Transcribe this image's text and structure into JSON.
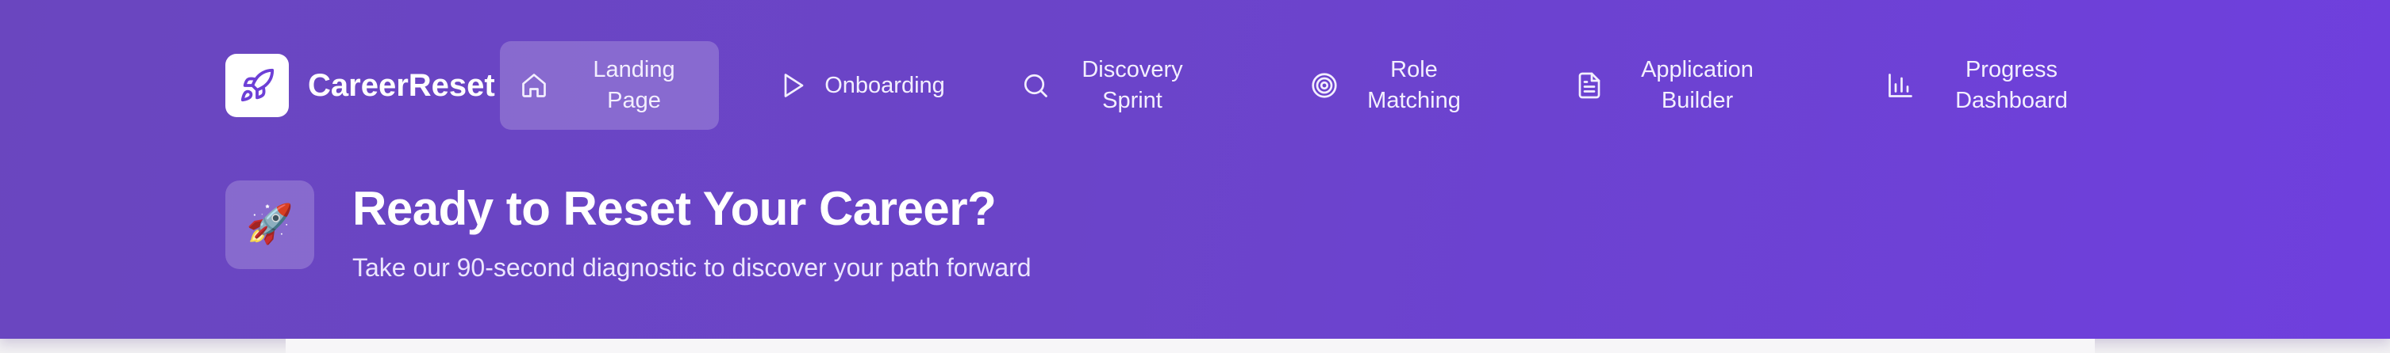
{
  "brand": {
    "name": "CareerReset",
    "logo_icon": "rocket-icon"
  },
  "nav": {
    "items": [
      {
        "icon": "home-icon",
        "line1": "Landing",
        "line2": "Page",
        "active": true
      },
      {
        "icon": "play-icon",
        "line1": "Onboarding",
        "line2": "",
        "active": false
      },
      {
        "icon": "search-icon",
        "line1": "Discovery",
        "line2": "Sprint",
        "active": false
      },
      {
        "icon": "target-icon",
        "line1": "Role",
        "line2": "Matching",
        "active": false
      },
      {
        "icon": "document-icon",
        "line1": "Application",
        "line2": "Builder",
        "active": false
      },
      {
        "icon": "bar-chart-icon",
        "line1": "Progress",
        "line2": "Dashboard",
        "active": false
      }
    ]
  },
  "hero": {
    "emoji": "🚀",
    "title": "Ready to Reset Your Career?",
    "subtitle": "Take our 90-second diagnostic to discover your path forward"
  },
  "colors": {
    "gradient_start": "#6a46bf",
    "gradient_end": "#6f3fde",
    "brand_icon": "#6d3fd6",
    "text_light": "#f3efff"
  }
}
